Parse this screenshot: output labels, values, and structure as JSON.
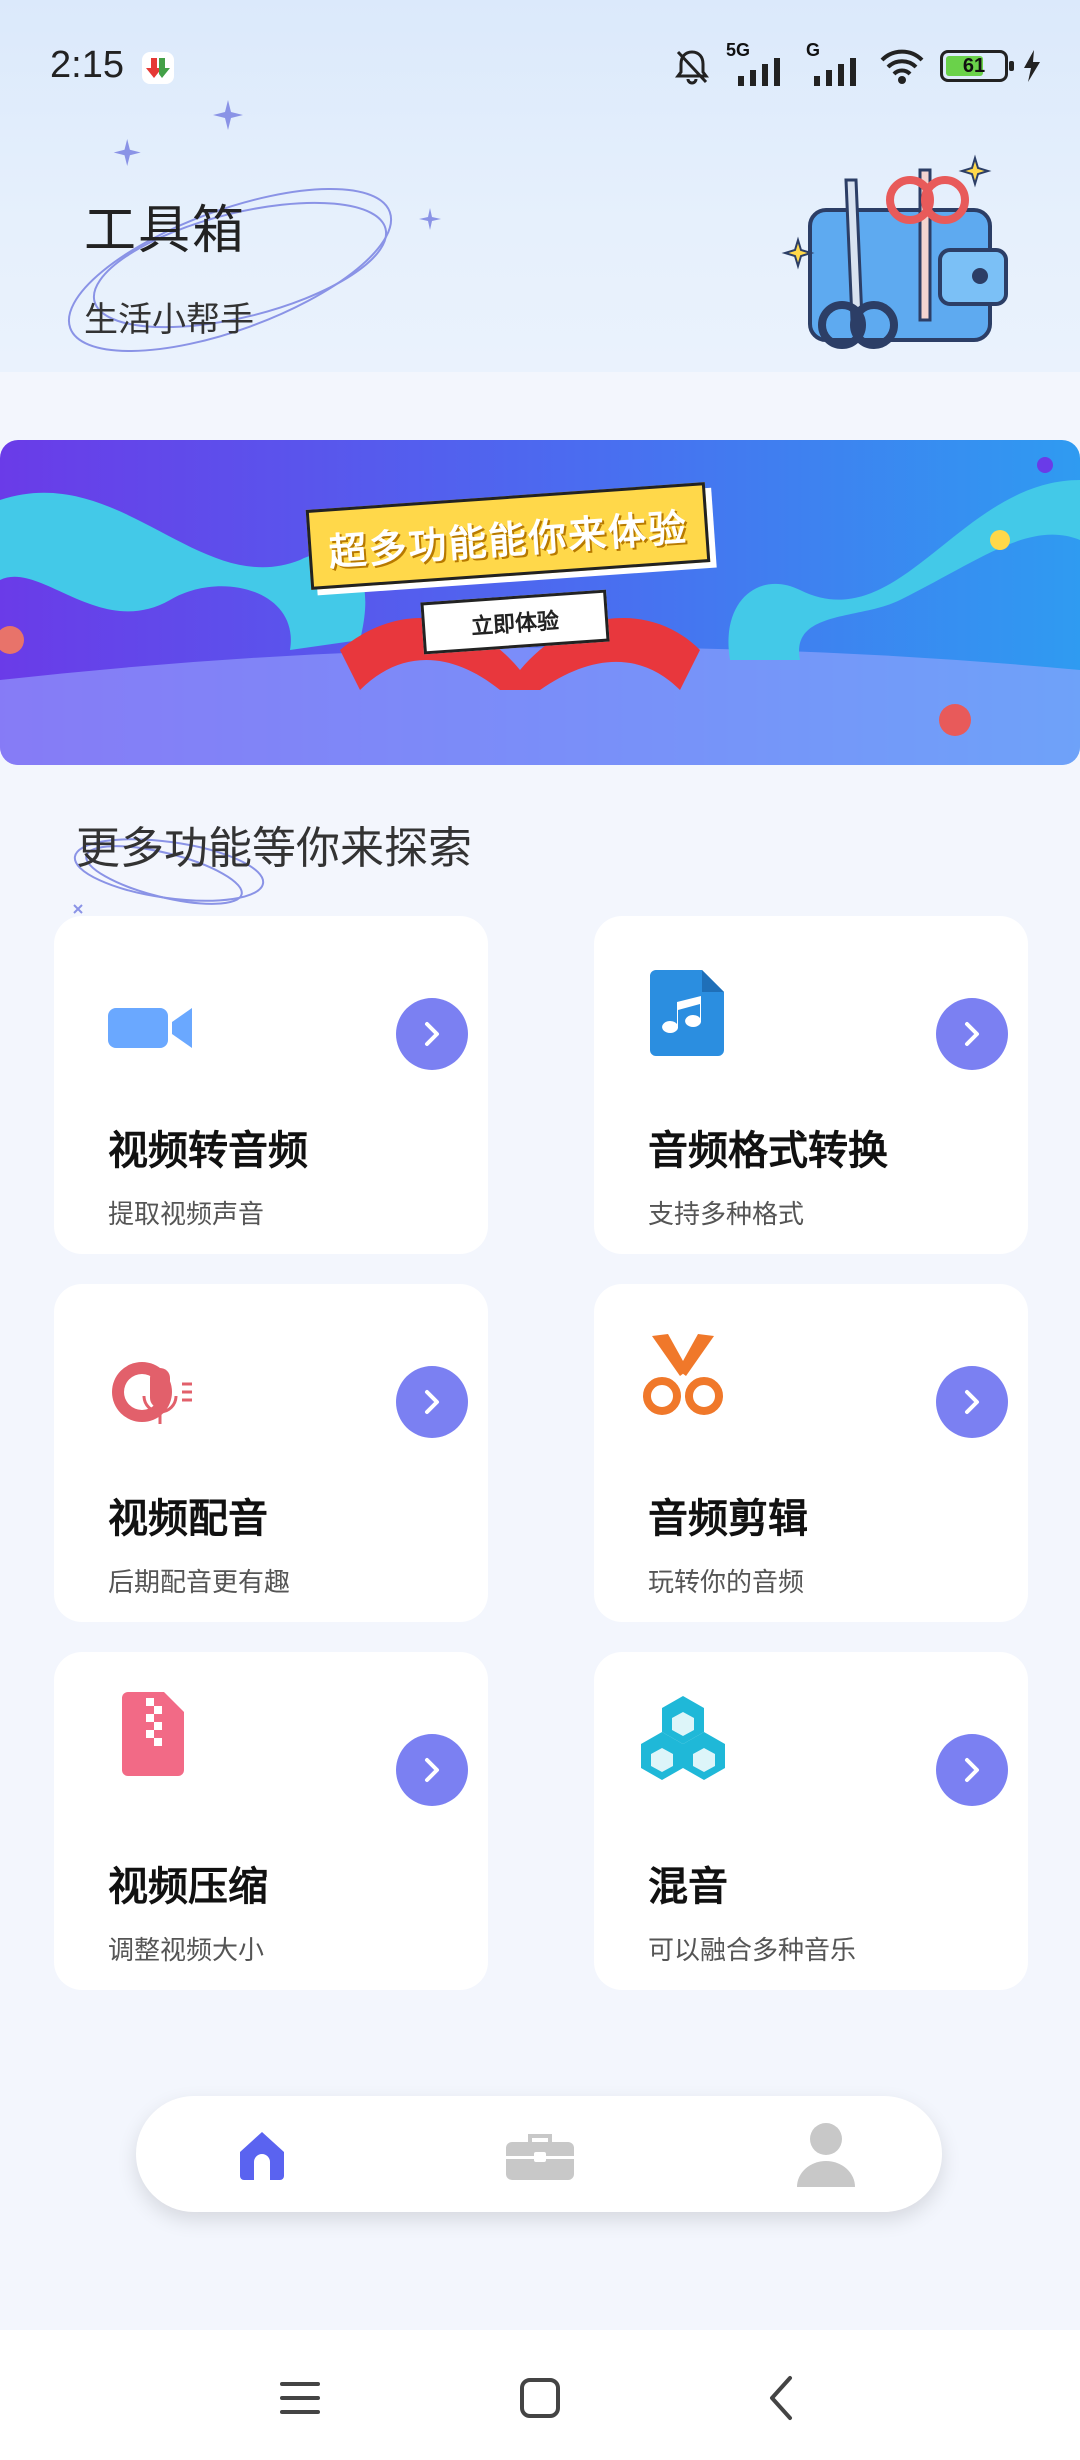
{
  "status_bar": {
    "time": "2:15",
    "network": "5G",
    "network2": "G",
    "battery": "61"
  },
  "header": {
    "title": "工具箱",
    "subtitle": "生活小帮手"
  },
  "banner": {
    "headline": "超多功能能你来体验",
    "cta": "立即体验"
  },
  "section": {
    "heading": "更多功能等你来探索"
  },
  "cards": [
    {
      "title": "视频转音频",
      "desc": "提取视频声音",
      "icon": "video-camera-icon",
      "color": "#6aa8ff"
    },
    {
      "title": "音频格式转换",
      "desc": "支持多种格式",
      "icon": "music-file-icon",
      "color": "#2b8ee0"
    },
    {
      "title": "视频配音",
      "desc": "后期配音更有趣",
      "icon": "microphone-icon",
      "color": "#e2606b"
    },
    {
      "title": "音频剪辑",
      "desc": "玩转你的音频",
      "icon": "scissors-icon",
      "color": "#f0782a"
    },
    {
      "title": "视频压缩",
      "desc": "调整视频大小",
      "icon": "zip-file-icon",
      "color": "#f26a86"
    },
    {
      "title": "混音",
      "desc": "可以融合多种音乐",
      "icon": "blocks-icon",
      "color": "#1fb8d8"
    }
  ],
  "bottom_nav": {
    "items": [
      "home-icon",
      "toolbox-icon",
      "profile-icon"
    ],
    "active_color": "#5a63f0",
    "inactive_color": "#c8c8c8"
  }
}
